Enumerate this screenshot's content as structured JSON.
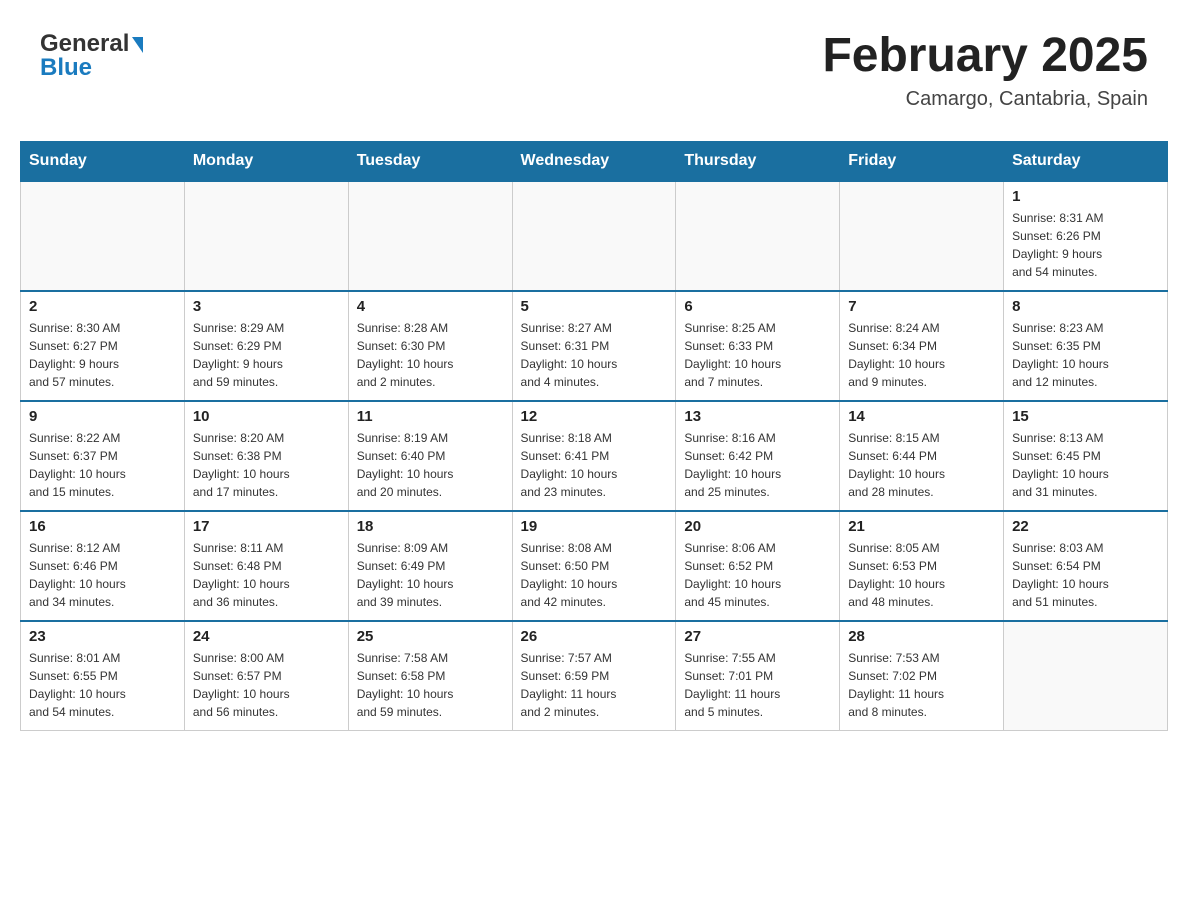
{
  "header": {
    "logo_general": "General",
    "logo_blue": "Blue",
    "month_title": "February 2025",
    "location": "Camargo, Cantabria, Spain"
  },
  "days_of_week": [
    "Sunday",
    "Monday",
    "Tuesday",
    "Wednesday",
    "Thursday",
    "Friday",
    "Saturday"
  ],
  "weeks": [
    {
      "days": [
        {
          "number": "",
          "info": ""
        },
        {
          "number": "",
          "info": ""
        },
        {
          "number": "",
          "info": ""
        },
        {
          "number": "",
          "info": ""
        },
        {
          "number": "",
          "info": ""
        },
        {
          "number": "",
          "info": ""
        },
        {
          "number": "1",
          "info": "Sunrise: 8:31 AM\nSunset: 6:26 PM\nDaylight: 9 hours\nand 54 minutes."
        }
      ]
    },
    {
      "days": [
        {
          "number": "2",
          "info": "Sunrise: 8:30 AM\nSunset: 6:27 PM\nDaylight: 9 hours\nand 57 minutes."
        },
        {
          "number": "3",
          "info": "Sunrise: 8:29 AM\nSunset: 6:29 PM\nDaylight: 9 hours\nand 59 minutes."
        },
        {
          "number": "4",
          "info": "Sunrise: 8:28 AM\nSunset: 6:30 PM\nDaylight: 10 hours\nand 2 minutes."
        },
        {
          "number": "5",
          "info": "Sunrise: 8:27 AM\nSunset: 6:31 PM\nDaylight: 10 hours\nand 4 minutes."
        },
        {
          "number": "6",
          "info": "Sunrise: 8:25 AM\nSunset: 6:33 PM\nDaylight: 10 hours\nand 7 minutes."
        },
        {
          "number": "7",
          "info": "Sunrise: 8:24 AM\nSunset: 6:34 PM\nDaylight: 10 hours\nand 9 minutes."
        },
        {
          "number": "8",
          "info": "Sunrise: 8:23 AM\nSunset: 6:35 PM\nDaylight: 10 hours\nand 12 minutes."
        }
      ]
    },
    {
      "days": [
        {
          "number": "9",
          "info": "Sunrise: 8:22 AM\nSunset: 6:37 PM\nDaylight: 10 hours\nand 15 minutes."
        },
        {
          "number": "10",
          "info": "Sunrise: 8:20 AM\nSunset: 6:38 PM\nDaylight: 10 hours\nand 17 minutes."
        },
        {
          "number": "11",
          "info": "Sunrise: 8:19 AM\nSunset: 6:40 PM\nDaylight: 10 hours\nand 20 minutes."
        },
        {
          "number": "12",
          "info": "Sunrise: 8:18 AM\nSunset: 6:41 PM\nDaylight: 10 hours\nand 23 minutes."
        },
        {
          "number": "13",
          "info": "Sunrise: 8:16 AM\nSunset: 6:42 PM\nDaylight: 10 hours\nand 25 minutes."
        },
        {
          "number": "14",
          "info": "Sunrise: 8:15 AM\nSunset: 6:44 PM\nDaylight: 10 hours\nand 28 minutes."
        },
        {
          "number": "15",
          "info": "Sunrise: 8:13 AM\nSunset: 6:45 PM\nDaylight: 10 hours\nand 31 minutes."
        }
      ]
    },
    {
      "days": [
        {
          "number": "16",
          "info": "Sunrise: 8:12 AM\nSunset: 6:46 PM\nDaylight: 10 hours\nand 34 minutes."
        },
        {
          "number": "17",
          "info": "Sunrise: 8:11 AM\nSunset: 6:48 PM\nDaylight: 10 hours\nand 36 minutes."
        },
        {
          "number": "18",
          "info": "Sunrise: 8:09 AM\nSunset: 6:49 PM\nDaylight: 10 hours\nand 39 minutes."
        },
        {
          "number": "19",
          "info": "Sunrise: 8:08 AM\nSunset: 6:50 PM\nDaylight: 10 hours\nand 42 minutes."
        },
        {
          "number": "20",
          "info": "Sunrise: 8:06 AM\nSunset: 6:52 PM\nDaylight: 10 hours\nand 45 minutes."
        },
        {
          "number": "21",
          "info": "Sunrise: 8:05 AM\nSunset: 6:53 PM\nDaylight: 10 hours\nand 48 minutes."
        },
        {
          "number": "22",
          "info": "Sunrise: 8:03 AM\nSunset: 6:54 PM\nDaylight: 10 hours\nand 51 minutes."
        }
      ]
    },
    {
      "days": [
        {
          "number": "23",
          "info": "Sunrise: 8:01 AM\nSunset: 6:55 PM\nDaylight: 10 hours\nand 54 minutes."
        },
        {
          "number": "24",
          "info": "Sunrise: 8:00 AM\nSunset: 6:57 PM\nDaylight: 10 hours\nand 56 minutes."
        },
        {
          "number": "25",
          "info": "Sunrise: 7:58 AM\nSunset: 6:58 PM\nDaylight: 10 hours\nand 59 minutes."
        },
        {
          "number": "26",
          "info": "Sunrise: 7:57 AM\nSunset: 6:59 PM\nDaylight: 11 hours\nand 2 minutes."
        },
        {
          "number": "27",
          "info": "Sunrise: 7:55 AM\nSunset: 7:01 PM\nDaylight: 11 hours\nand 5 minutes."
        },
        {
          "number": "28",
          "info": "Sunrise: 7:53 AM\nSunset: 7:02 PM\nDaylight: 11 hours\nand 8 minutes."
        },
        {
          "number": "",
          "info": ""
        }
      ]
    }
  ]
}
